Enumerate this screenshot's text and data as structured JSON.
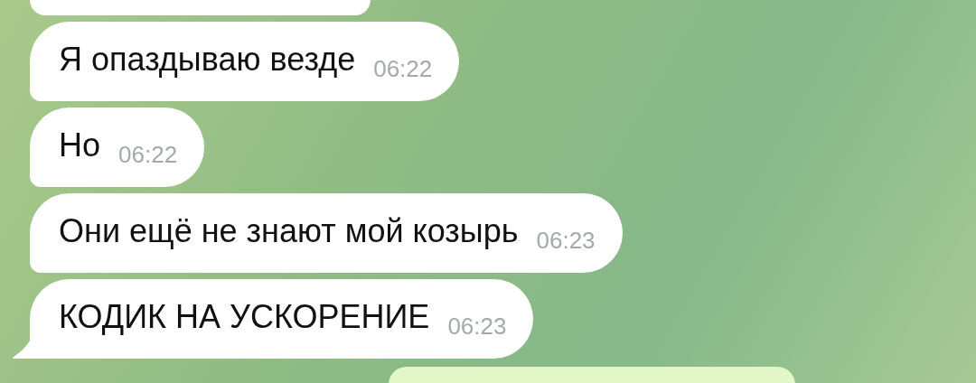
{
  "messages": [
    {
      "kind": "cut_incoming"
    },
    {
      "kind": "incoming",
      "text": "Я опаздываю везде",
      "time": "06:22",
      "tail": false
    },
    {
      "kind": "incoming",
      "text": "Но",
      "time": "06:22",
      "tail": false
    },
    {
      "kind": "incoming",
      "text": "Они ещё не знают мой козырь",
      "time": "06:23",
      "tail": false
    },
    {
      "kind": "incoming",
      "text": "КОДИК НА УСКОРЕНИЕ",
      "time": "06:23",
      "tail": true
    },
    {
      "kind": "cut_outgoing"
    }
  ]
}
